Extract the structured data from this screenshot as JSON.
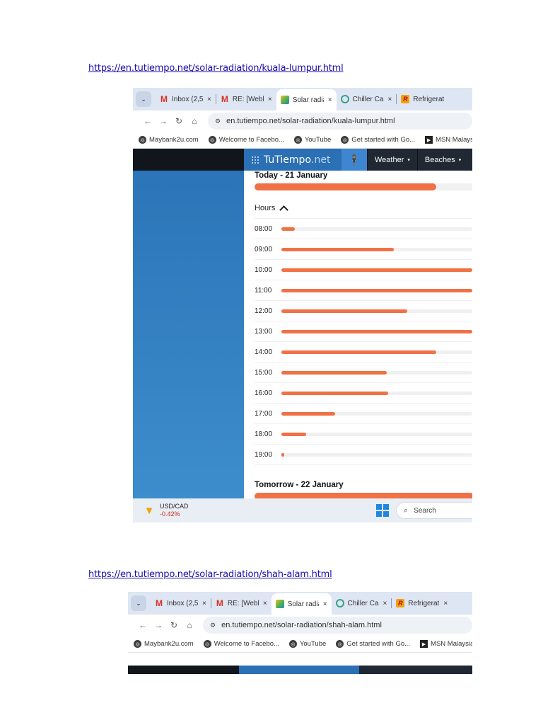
{
  "links": {
    "first": "https://en.tutiempo.net/solar-radiation/kuala-lumpur.html",
    "second": "https://en.tutiempo.net/solar-radiation/shah-alam.html"
  },
  "browser1": {
    "tabs": [
      {
        "icon": "gmail-icon",
        "title": "Inbox (2,5",
        "close": "×"
      },
      {
        "icon": "gmail-icon",
        "title": "RE: [Weble",
        "close": "×"
      },
      {
        "icon": "solar-icon",
        "title": "Solar radia",
        "close": "×"
      },
      {
        "icon": "chiller-icon",
        "title": "Chiller Cap",
        "close": "×"
      },
      {
        "icon": "refrigeration-icon",
        "title": "Refrigerati",
        "close": ""
      }
    ],
    "url": "en.tutiempo.net/solar-radiation/kuala-lumpur.html",
    "bookmarks": [
      "Maybank2u.com",
      "Welcome to Facebo...",
      "YouTube",
      "Get started with Go...",
      "MSN Malaysia - O"
    ]
  },
  "browser2": {
    "tabs": [
      {
        "icon": "gmail-icon",
        "title": "Inbox (2,5",
        "close": "×"
      },
      {
        "icon": "gmail-icon",
        "title": "RE: [Weble",
        "close": "×"
      },
      {
        "icon": "solar-icon",
        "title": "Solar radia",
        "close": "×"
      },
      {
        "icon": "chiller-icon",
        "title": "Chiller Cap",
        "close": "×"
      },
      {
        "icon": "refrigeration-icon",
        "title": "Refrigerati",
        "close": "×"
      }
    ],
    "url": "en.tutiempo.net/solar-radiation/shah-alam.html",
    "bookmarks": [
      "Maybank2u.com",
      "Welcome to Facebo...",
      "YouTube",
      "Get started with Go...",
      "MSN Malaysia - Ou"
    ]
  },
  "site": {
    "logo_tu": "TuTiempo",
    "logo_net": ".net",
    "menu": [
      "Weather",
      "Beaches"
    ],
    "today_title": "Today - 21 January",
    "today_fraction": 0.83,
    "hours_label": "Hours",
    "hours": [
      {
        "time": "08:00",
        "fraction": 0.07
      },
      {
        "time": "09:00",
        "fraction": 0.59
      },
      {
        "time": "10:00",
        "fraction": 1.0
      },
      {
        "time": "11:00",
        "fraction": 1.0
      },
      {
        "time": "12:00",
        "fraction": 0.66
      },
      {
        "time": "13:00",
        "fraction": 1.0
      },
      {
        "time": "14:00",
        "fraction": 0.81
      },
      {
        "time": "15:00",
        "fraction": 0.55
      },
      {
        "time": "16:00",
        "fraction": 0.56
      },
      {
        "time": "17:00",
        "fraction": 0.28
      },
      {
        "time": "18:00",
        "fraction": 0.13
      },
      {
        "time": "19:00",
        "fraction": 0.015
      }
    ],
    "tomorrow_title": "Tomorrow - 22 January",
    "tomorrow_fraction": 1.0
  },
  "taskbar": {
    "ticker_symbol": "USD/CAD",
    "ticker_change": "-0.42%",
    "search_placeholder": "Search"
  },
  "colors": {
    "bar": "#f07146",
    "sidebar": "#2a73b6",
    "header": "#1f2833"
  }
}
